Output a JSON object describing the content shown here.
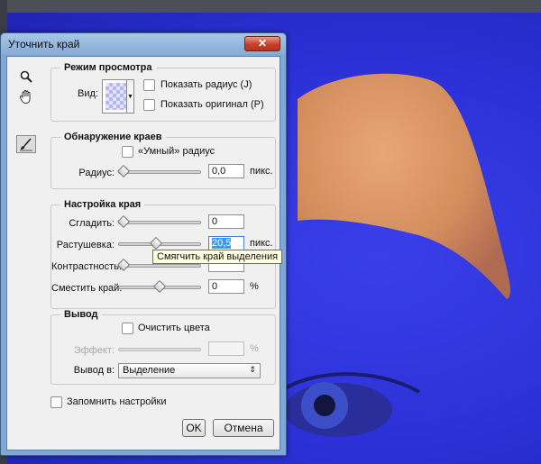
{
  "dialog": {
    "title": "Уточнить край",
    "close_label": "✕"
  },
  "tools": [
    "zoom-icon",
    "hand-icon",
    "refine-radius-brush-icon"
  ],
  "view_mode": {
    "title": "Режим просмотра",
    "view_label": "Вид:",
    "show_radius_label": "Показать радиус (J)",
    "show_original_label": "Показать оригинал (P)",
    "show_radius_checked": false,
    "show_original_checked": false
  },
  "edge_detection": {
    "title": "Обнаружение краев",
    "smart_radius_label": "«Умный» радиус",
    "smart_radius_checked": false,
    "radius_label": "Радиус:",
    "radius_value": "0,0",
    "radius_unit": "пикс.",
    "radius_level": 0
  },
  "adjust_edge": {
    "title": "Настройка края",
    "smooth_label": "Сгладить:",
    "smooth_value": "0",
    "smooth_level": 0,
    "feather_label": "Растушевка:",
    "feather_value": "20,5",
    "feather_unit": "пикс.",
    "feather_level": 0.45,
    "contrast_label": "Контрастность:",
    "contrast_level": 0,
    "shift_label": "Сместить край:",
    "shift_value": "0",
    "shift_unit": "%",
    "shift_level": 0.5,
    "tooltip": "Смягчить край выделения"
  },
  "output": {
    "title": "Вывод",
    "decontaminate_label": "Очистить цвета",
    "decontaminate_checked": false,
    "amount_label": "Эффект:",
    "amount_unit": "%",
    "output_to_label": "Вывод в:",
    "output_to_value": "Выделение"
  },
  "remember_label": "Запомнить настройки",
  "remember_checked": false,
  "buttons": {
    "ok": "OK",
    "cancel": "Отмена"
  },
  "colors": {
    "overlay": "#2b30d6",
    "selection": "#d9925e",
    "dialog_frame": "#7fa9d4",
    "highlight": "#3399ff"
  }
}
